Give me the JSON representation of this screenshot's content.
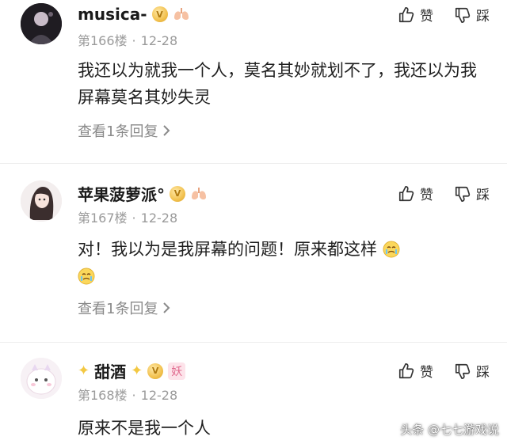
{
  "comments": [
    {
      "username": "musica-",
      "floor": "第166楼",
      "date": "12-28",
      "text": "我还以为就我一个人，莫名其妙就划不了，我还以为我屏幕莫名其妙失灵",
      "replies_label": "查看1条回复",
      "like_label": "赞",
      "dislike_label": "踩"
    },
    {
      "username": "苹果菠萝派°",
      "floor": "第167楼",
      "date": "12-28",
      "text": "对！我以为是我屏幕的问题！原来都这样",
      "replies_label": "查看1条回复",
      "like_label": "赞",
      "dislike_label": "踩"
    },
    {
      "username": "甜酒",
      "floor": "第168楼",
      "date": "12-28",
      "text": "原来不是我一个人",
      "like_label": "赞",
      "dislike_label": "踩",
      "badge_text": "妖"
    }
  ],
  "watermark": "头条 @七七游戏说",
  "icons": {
    "like": "thumbs-up-icon",
    "dislike": "thumbs-down-icon",
    "chevron": "chevron-right-icon",
    "level_badge": "level-v-badge-icon",
    "lungs": "lungs-badge-icon",
    "sparkle": "sparkle-icon",
    "emoji": "crying-face-emoji"
  },
  "colors": {
    "meta_gray": "#9a9a9a",
    "badge_gold": "#f2c14e",
    "badge_pink": "#e06a8e"
  }
}
